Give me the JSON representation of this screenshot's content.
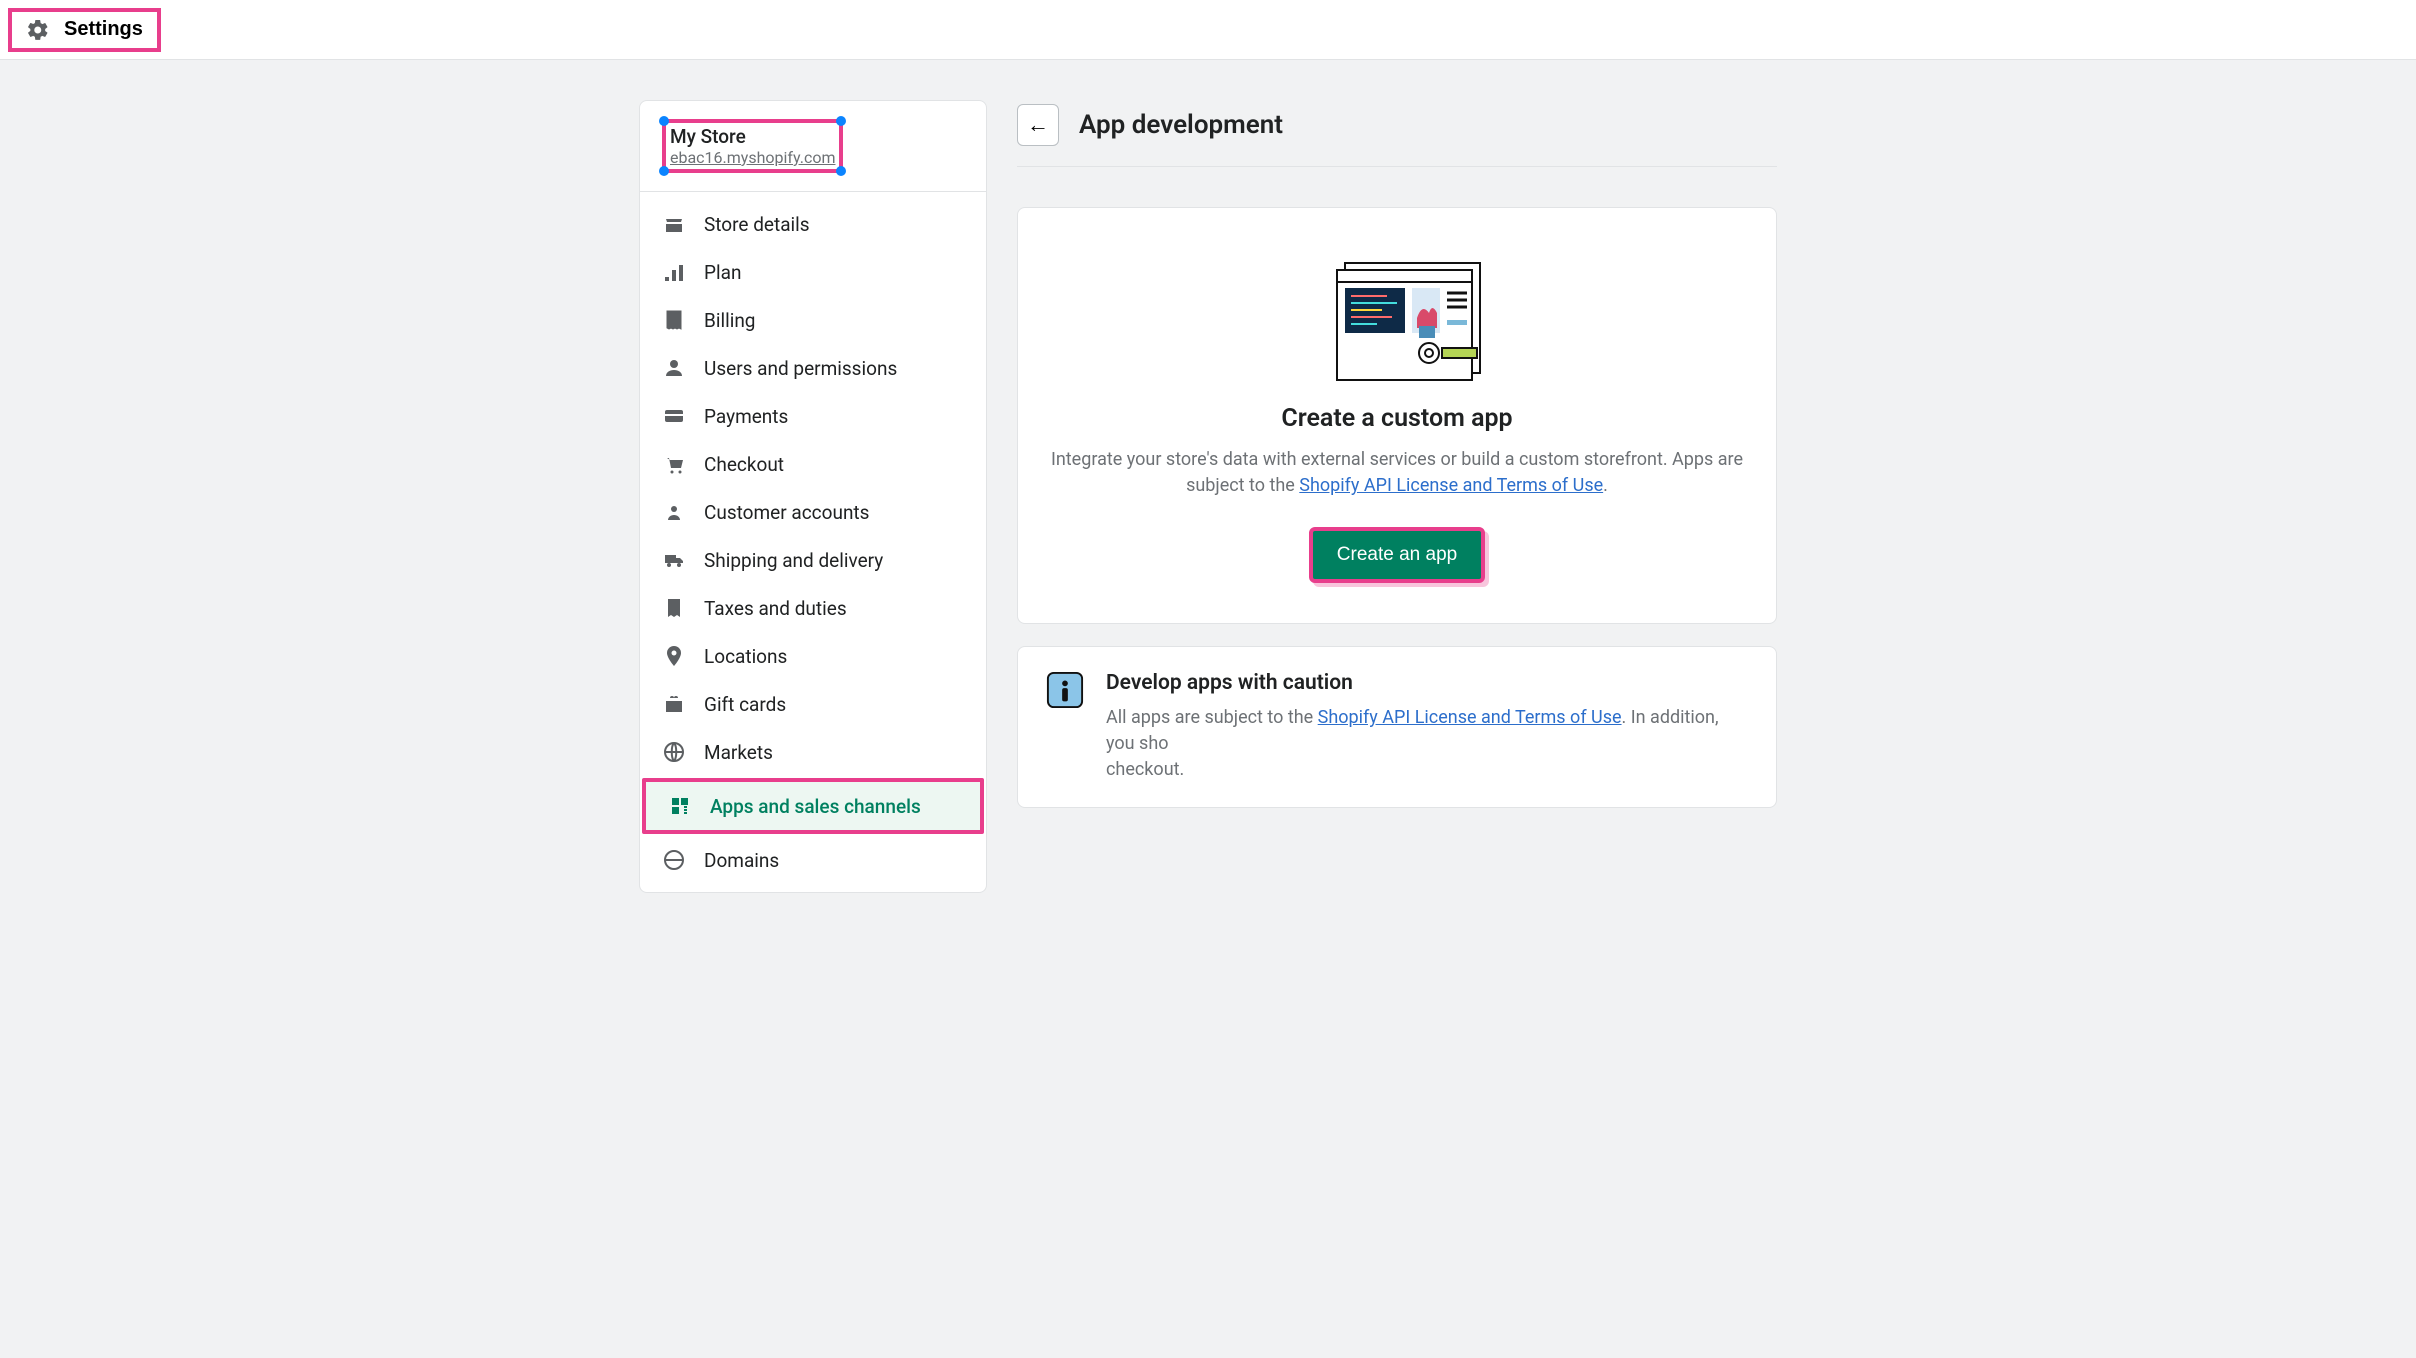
{
  "topbar": {
    "settings_label": "Settings"
  },
  "sidebar": {
    "store_name": "My Store",
    "store_url": "ebac16.myshopify.com",
    "items": [
      {
        "icon": "store-icon",
        "label": "Store details"
      },
      {
        "icon": "plan-icon",
        "label": "Plan"
      },
      {
        "icon": "billing-icon",
        "label": "Billing"
      },
      {
        "icon": "users-icon",
        "label": "Users and permissions"
      },
      {
        "icon": "payments-icon",
        "label": "Payments"
      },
      {
        "icon": "checkout-icon",
        "label": "Checkout"
      },
      {
        "icon": "customers-icon",
        "label": "Customer accounts"
      },
      {
        "icon": "shipping-icon",
        "label": "Shipping and delivery"
      },
      {
        "icon": "taxes-icon",
        "label": "Taxes and duties"
      },
      {
        "icon": "locations-icon",
        "label": "Locations"
      },
      {
        "icon": "gift-icon",
        "label": "Gift cards"
      },
      {
        "icon": "markets-icon",
        "label": "Markets"
      },
      {
        "icon": "apps-icon",
        "label": "Apps and sales channels",
        "active": true,
        "highlighted": true
      },
      {
        "icon": "domains-icon",
        "label": "Domains"
      }
    ]
  },
  "main": {
    "page_title": "App development",
    "empty_state": {
      "title": "Create a custom app",
      "desc_before": "Integrate your store's data with external services or build a custom storefront. Apps are subject to the ",
      "link_text": "Shopify API License and Terms of Use",
      "desc_after": ".",
      "cta_label": "Create an app"
    },
    "caution": {
      "title": "Develop apps with caution",
      "text_before": "All apps are subject to the ",
      "link_text": "Shopify API License and Terms of Use",
      "text_after": ". In addition, you sho",
      "text_line2": "checkout."
    }
  }
}
